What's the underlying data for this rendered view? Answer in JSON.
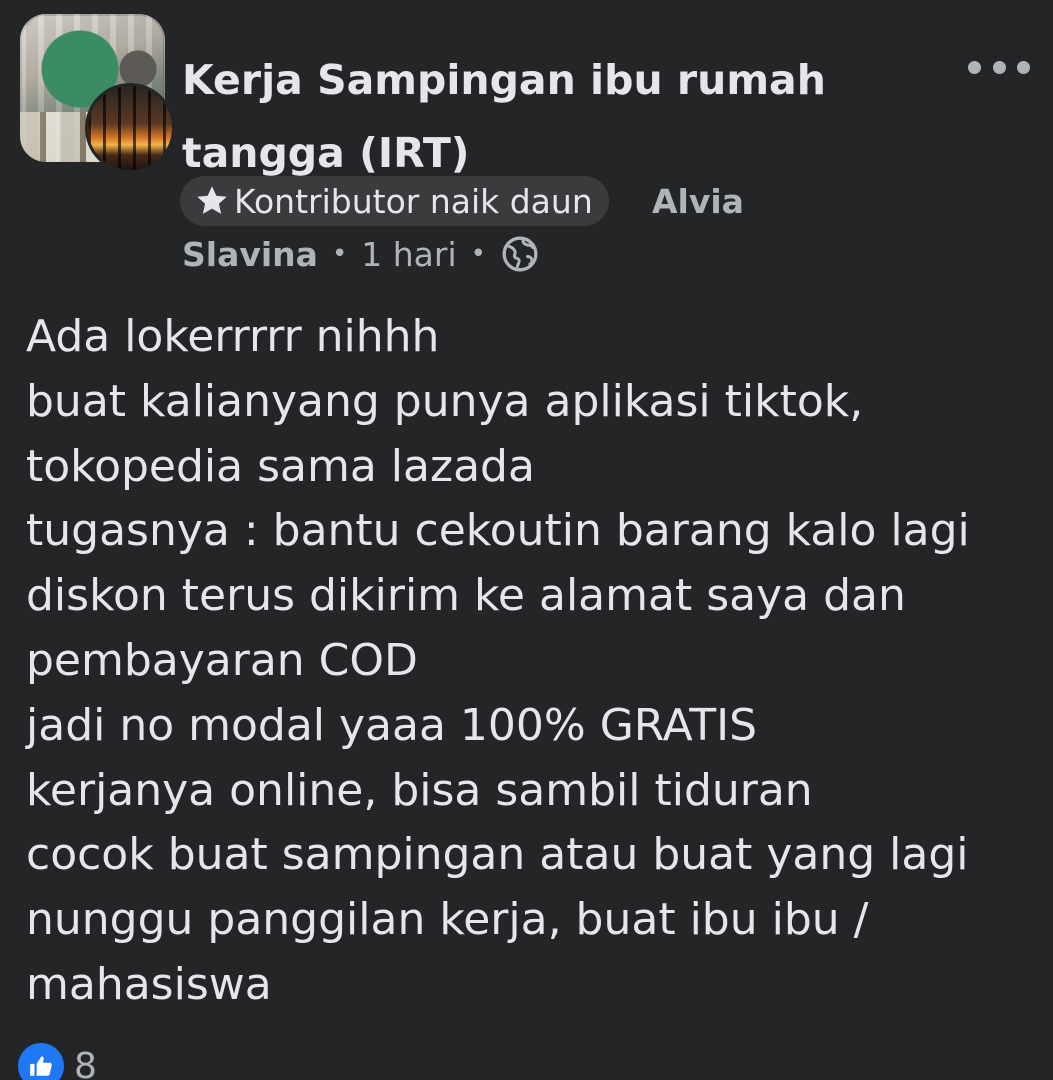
{
  "post": {
    "group_name": "Kerja Sampingan ibu rumah tangga (IRT)",
    "badge": {
      "icon": "star-icon",
      "label": "Kontributor naik daun"
    },
    "author": {
      "first_name": "Alvia",
      "last_name": "Slavina"
    },
    "time": "1 hari",
    "separator": "•",
    "privacy_icon": "globe-icon",
    "more_icon": "more-options-icon",
    "body_lines": [
      "Ada lokerrrrr nihhh",
      "buat kalianyang punya aplikasi tiktok,",
      "tokopedia sama lazada",
      "tugasnya : bantu cekoutin barang kalo lagi",
      "diskon terus dikirim ke alamat saya dan",
      "pembayaran COD",
      "jadi no modal yaaa 100% GRATIS",
      "kerjanya online, bisa sambil tiduran",
      "cocok buat sampingan atau buat yang lagi",
      "nunggu panggilan kerja, buat ibu ibu /",
      "mahasiswa"
    ],
    "reactions": {
      "icon": "like-icon",
      "count": "8"
    }
  },
  "colors": {
    "background": "#242526",
    "text_primary": "#e4e6eb",
    "text_secondary": "#b0b3b8",
    "badge_bg": "#3a3b3c",
    "like_blue": "#2078f4"
  }
}
